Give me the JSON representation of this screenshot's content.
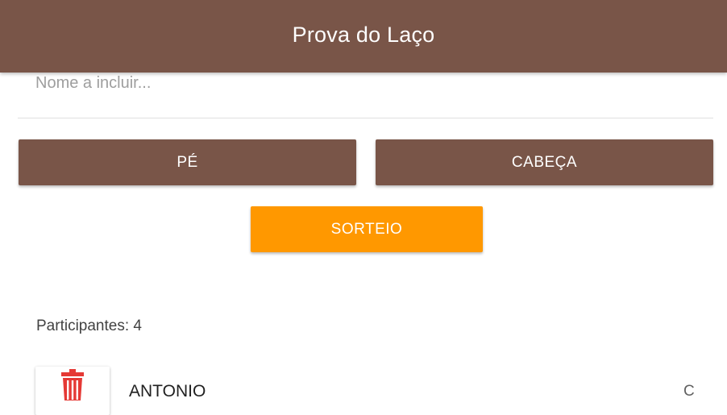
{
  "appbar": {
    "title": "Prova do Laço"
  },
  "form": {
    "name_placeholder": "Nome a incluir...",
    "name_value": ""
  },
  "buttons": {
    "pe_label": "PÉ",
    "cabeca_label": "CABEÇA",
    "sorteio_label": "SORTEIO"
  },
  "participants": {
    "label": "Participantes: 4",
    "items": [
      {
        "name": "ANTONIO",
        "tag": "C",
        "delete_icon": "trash-icon"
      }
    ]
  },
  "colors": {
    "primary": "#795548",
    "accent": "#ff9800",
    "delete": "#e53935"
  }
}
